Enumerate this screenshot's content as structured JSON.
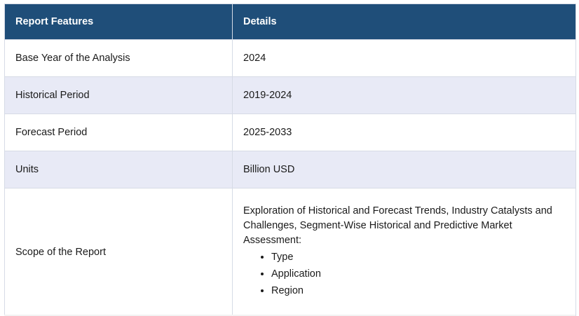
{
  "table": {
    "headers": [
      "Report Features",
      "Details"
    ],
    "rows": [
      {
        "feature": "Base Year of the Analysis",
        "detail": "2024"
      },
      {
        "feature": "Historical Period",
        "detail": "2019-2024"
      },
      {
        "feature": "Forecast Period",
        "detail": "2025-2033"
      },
      {
        "feature": "Units",
        "detail": "Billion USD"
      }
    ],
    "scope": {
      "feature": "Scope of the Report",
      "description": "Exploration of Historical and Forecast Trends, Industry Catalysts and Challenges, Segment-Wise Historical and Predictive Market Assessment:",
      "items": [
        "Type",
        "Application",
        "Region"
      ]
    }
  },
  "colors": {
    "header_bg": "#1f4e79",
    "header_text": "#ffffff",
    "alt_row_bg": "#e8eaf6",
    "border": "#d6dbe6"
  }
}
